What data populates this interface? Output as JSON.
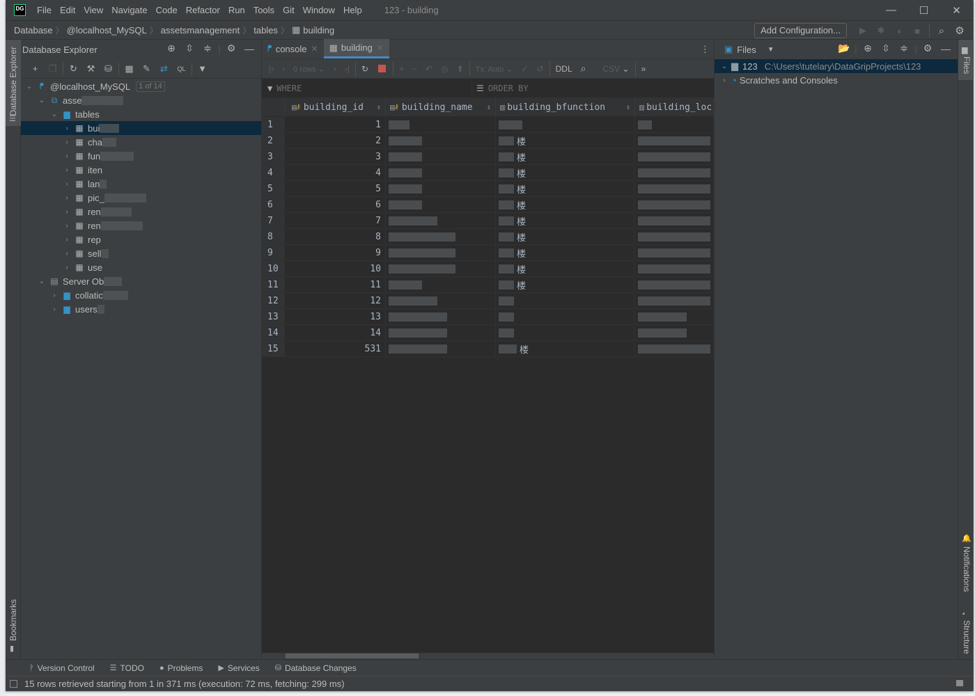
{
  "window": {
    "title": "123 - building",
    "logo": "DG",
    "menu": [
      "File",
      "Edit",
      "View",
      "Navigate",
      "Code",
      "Refactor",
      "Run",
      "Tools",
      "Git",
      "Window",
      "Help"
    ],
    "controls": {
      "minimize": "—",
      "maximize": "☐",
      "close": "✕"
    }
  },
  "navbar": {
    "breadcrumbs": [
      "Database",
      "@localhost_MySQL",
      "assetsmanagement",
      "tables",
      "building"
    ],
    "add_configuration": "Add Configuration..."
  },
  "left_stripe": {
    "database_explorer": "Database Explorer",
    "bookmarks": "Bookmarks"
  },
  "right_stripe": {
    "files": "Files",
    "notifications": "Notifications",
    "structure": "Structure"
  },
  "db_explorer": {
    "title": "Database Explorer",
    "tree": [
      {
        "label": "@localhost_MySQL",
        "badge": "1 of 14",
        "level": 0,
        "expanded": true,
        "icon": "mysql-connection-icon"
      },
      {
        "label": "asse",
        "level": 1,
        "expanded": true,
        "icon": "schema-icon"
      },
      {
        "label": "tables",
        "level": 2,
        "expanded": true,
        "icon": "folder-icon"
      },
      {
        "label": "bui",
        "level": 3,
        "icon": "table-icon",
        "selected": true
      },
      {
        "label": "cha",
        "level": 3,
        "icon": "table-icon"
      },
      {
        "label": "fun",
        "level": 3,
        "icon": "table-icon"
      },
      {
        "label": "iten",
        "level": 3,
        "icon": "table-icon"
      },
      {
        "label": "lan",
        "level": 3,
        "icon": "table-icon"
      },
      {
        "label": "pic_",
        "level": 3,
        "icon": "table-icon"
      },
      {
        "label": "ren",
        "level": 3,
        "icon": "table-icon"
      },
      {
        "label": "ren",
        "level": 3,
        "icon": "table-icon"
      },
      {
        "label": "rep",
        "level": 3,
        "icon": "table-icon"
      },
      {
        "label": "sell",
        "level": 3,
        "icon": "table-icon"
      },
      {
        "label": "use",
        "level": 3,
        "icon": "table-icon"
      },
      {
        "label": "Server Ob",
        "level": 1,
        "expanded": true,
        "icon": "server-objects-icon"
      },
      {
        "label": "collatic",
        "level": 2,
        "icon": "folder-icon"
      },
      {
        "label": "users",
        "level": 2,
        "icon": "folder-icon"
      }
    ]
  },
  "editor": {
    "tabs": [
      {
        "label": "console",
        "active": false
      },
      {
        "label": "building",
        "active": true
      }
    ],
    "toolbar": {
      "rows": "0 rows",
      "tx": "Tx: Auto",
      "ddl": "DDL",
      "export": "CSV"
    },
    "where": "WHERE",
    "order_by": "ORDER BY",
    "columns": [
      "building_id",
      "building_name",
      "building_bfunction",
      "building_loc"
    ],
    "rows": [
      {
        "n": "1",
        "id": "1",
        "name": "",
        "func": "",
        "loc": ""
      },
      {
        "n": "2",
        "id": "2",
        "name": "",
        "func": "楼",
        "loc": ""
      },
      {
        "n": "3",
        "id": "3",
        "name": "",
        "func": "楼",
        "loc": ""
      },
      {
        "n": "4",
        "id": "4",
        "name": "",
        "func": "楼",
        "loc": ""
      },
      {
        "n": "5",
        "id": "5",
        "name": "",
        "func": "楼",
        "loc": ""
      },
      {
        "n": "6",
        "id": "6",
        "name": "",
        "func": "楼",
        "loc": ""
      },
      {
        "n": "7",
        "id": "7",
        "name": "",
        "func": "楼",
        "loc": ""
      },
      {
        "n": "8",
        "id": "8",
        "name": "",
        "func": "楼",
        "loc": ""
      },
      {
        "n": "9",
        "id": "9",
        "name": "",
        "func": "楼",
        "loc": ""
      },
      {
        "n": "10",
        "id": "10",
        "name": "",
        "func": "楼",
        "loc": ""
      },
      {
        "n": "11",
        "id": "11",
        "name": "",
        "func": "楼",
        "loc": ""
      },
      {
        "n": "12",
        "id": "12",
        "name": "",
        "func": "",
        "loc": ""
      },
      {
        "n": "13",
        "id": "13",
        "name": "",
        "func": "",
        "loc": ""
      },
      {
        "n": "14",
        "id": "14",
        "name": "",
        "func": "",
        "loc": ""
      },
      {
        "n": "15",
        "id": "531",
        "name": "",
        "func": "楼",
        "loc": ""
      }
    ]
  },
  "files_panel": {
    "title": "Files",
    "items": [
      {
        "label": "123",
        "path": "C:\\Users\\tutelary\\DataGripProjects\\123",
        "expanded": true,
        "selected": true
      },
      {
        "label": "Scratches and Consoles",
        "expanded": false
      }
    ]
  },
  "tool_windows": [
    "Version Control",
    "TODO",
    "Problems",
    "Services",
    "Database Changes"
  ],
  "status": "15 rows retrieved starting from 1 in 371 ms (execution: 72 ms, fetching: 299 ms)"
}
